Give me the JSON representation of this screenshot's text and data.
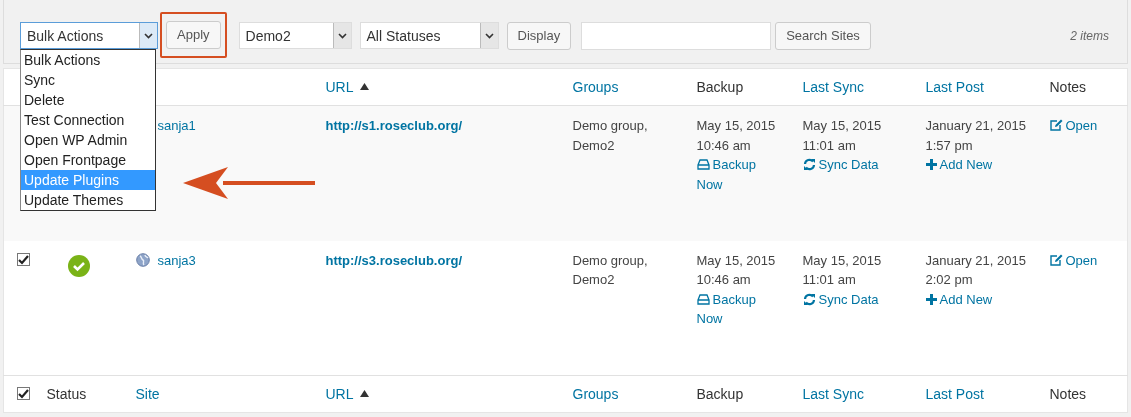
{
  "toolbar": {
    "bulk_actions": {
      "value": "Bulk Actions",
      "expanded": true,
      "options": [
        {
          "label": "Bulk Actions",
          "highlighted": false
        },
        {
          "label": "Sync",
          "highlighted": false
        },
        {
          "label": "Delete",
          "highlighted": false
        },
        {
          "label": "Test Connection",
          "highlighted": false
        },
        {
          "label": "Open WP Admin",
          "highlighted": false
        },
        {
          "label": "Open Frontpage",
          "highlighted": false
        },
        {
          "label": "Update Plugins",
          "highlighted": true
        },
        {
          "label": "Update Themes",
          "highlighted": false
        }
      ]
    },
    "apply_button": {
      "label": "Apply",
      "highlighted": true
    },
    "group_filter": {
      "value": "Demo2"
    },
    "status_filter": {
      "value": "All Statuses"
    },
    "display_button": "Display",
    "search_button": "Search Sites",
    "item_count": "2 items"
  },
  "callout_arrow": true,
  "table": {
    "header": [
      {
        "label": "URL",
        "sortable": true,
        "sorted": true
      },
      {
        "label": "Groups",
        "sortable": true
      },
      {
        "label": "Backup",
        "sortable": false
      },
      {
        "label": "Last Sync",
        "sortable": true
      },
      {
        "label": "Last Post",
        "sortable": true
      },
      {
        "label": "Notes",
        "sortable": false
      }
    ],
    "rows": [
      {
        "site": "sanja1",
        "url": "http://s1.roseclub.org/",
        "groups": "Demo group, Demo2",
        "backup": {
          "date": "May 15, 2015",
          "time": "10:46 am",
          "action": "Backup Now"
        },
        "last_sync": {
          "date": "May 15, 2015",
          "time": "11:01 am",
          "action": "Sync Data"
        },
        "last_post": {
          "date": "January 21, 2015",
          "time": "1:57 pm",
          "action": "Add New"
        },
        "notes": "Open"
      },
      {
        "checked": true,
        "online": true,
        "site_icon": true,
        "site": "sanja3",
        "url": "http://s3.roseclub.org/",
        "groups": "Demo group, Demo2",
        "backup": {
          "date": "May 15, 2015",
          "time": "10:46 am",
          "action": "Backup Now"
        },
        "last_sync": {
          "date": "May 15, 2015",
          "time": "11:01 am",
          "action": "Sync Data"
        },
        "last_post": {
          "date": "January 21, 2015",
          "time": "2:02 pm",
          "action": "Add New"
        },
        "notes": "Open"
      }
    ],
    "footer": {
      "checked": true,
      "columns": [
        {
          "label": "Status",
          "sortable": false
        },
        {
          "label": "Site",
          "sortable": true
        },
        {
          "label": "URL",
          "sortable": true,
          "sorted": true
        },
        {
          "label": "Groups",
          "sortable": true
        },
        {
          "label": "Backup",
          "sortable": false
        },
        {
          "label": "Last Sync",
          "sortable": true
        },
        {
          "label": "Last Post",
          "sortable": true
        },
        {
          "label": "Notes",
          "sortable": false
        }
      ]
    }
  }
}
